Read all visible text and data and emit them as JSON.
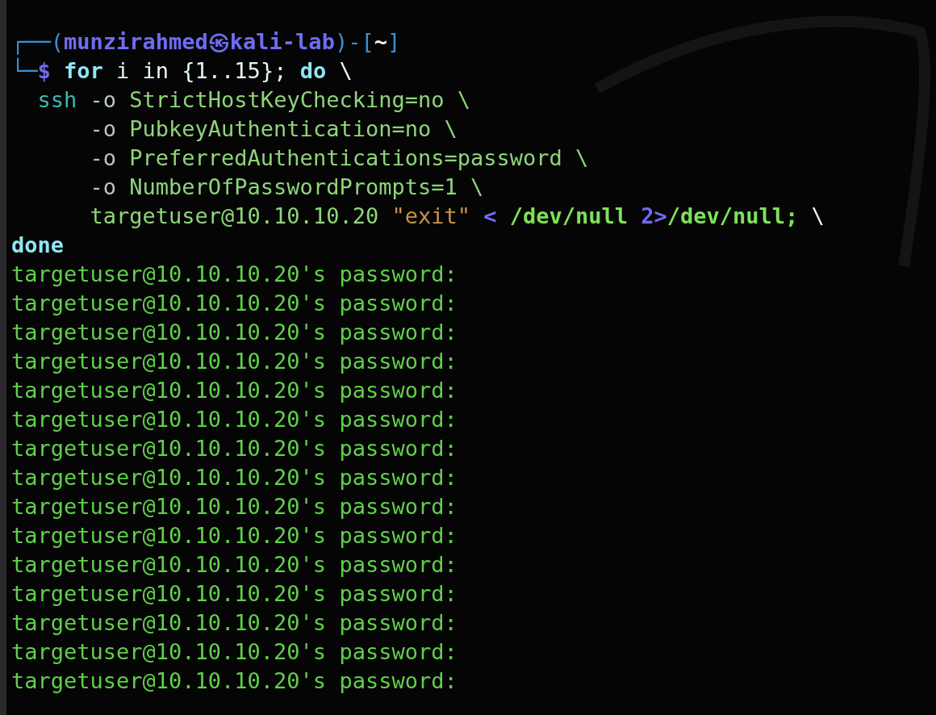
{
  "terminal": {
    "lines": [
      [
        {
          "text": "┌──(",
          "kind": "frame"
        },
        {
          "text": "munzirahmed㉿kali-lab",
          "kind": "userhost"
        },
        {
          "text": ")-[",
          "kind": "frame"
        },
        {
          "text": "~",
          "kind": "cwd"
        },
        {
          "text": "]",
          "kind": "frame"
        }
      ],
      [
        {
          "text": "└─",
          "kind": "frame"
        },
        {
          "text": "$",
          "kind": "dollar"
        },
        {
          "text": " for",
          "kind": "keyword"
        },
        {
          "text": " i in {1..15}; ",
          "kind": "plain"
        },
        {
          "text": "do",
          "kind": "keyword"
        },
        {
          "text": " \\",
          "kind": "plain"
        }
      ],
      [
        {
          "text": "  ssh",
          "kind": "command"
        },
        {
          "text": " -o",
          "kind": "option"
        },
        {
          "text": " StrictHostKeyChecking=no \\",
          "kind": "arg"
        }
      ],
      [
        {
          "text": "      -o",
          "kind": "option"
        },
        {
          "text": " PubkeyAuthentication=no \\",
          "kind": "arg"
        }
      ],
      [
        {
          "text": "      -o",
          "kind": "option"
        },
        {
          "text": " PreferredAuthentications=password \\",
          "kind": "arg"
        }
      ],
      [
        {
          "text": "      -o",
          "kind": "option"
        },
        {
          "text": " NumberOfPasswordPrompts=1 \\",
          "kind": "arg"
        }
      ],
      [
        {
          "text": "      targetuser@10.10.10.20 ",
          "kind": "arg"
        },
        {
          "text": "\"exit\" ",
          "kind": "string"
        },
        {
          "text": "<",
          "kind": "redirect"
        },
        {
          "text": " /dev/null ",
          "kind": "path"
        },
        {
          "text": "2>",
          "kind": "redirect"
        },
        {
          "text": "/dev/null;",
          "kind": "path"
        },
        {
          "text": " \\",
          "kind": "plain"
        }
      ],
      [
        {
          "text": "done",
          "kind": "keyword"
        }
      ]
    ],
    "output": [
      "targetuser@10.10.10.20's password:",
      "targetuser@10.10.10.20's password:",
      "targetuser@10.10.10.20's password:",
      "targetuser@10.10.10.20's password:",
      "targetuser@10.10.10.20's password:",
      "targetuser@10.10.10.20's password:",
      "targetuser@10.10.10.20's password:",
      "targetuser@10.10.10.20's password:",
      "targetuser@10.10.10.20's password:",
      "targetuser@10.10.10.20's password:",
      "targetuser@10.10.10.20's password:",
      "targetuser@10.10.10.20's password:",
      "targetuser@10.10.10.20's password:",
      "targetuser@10.10.10.20's password:",
      "targetuser@10.10.10.20's password:"
    ]
  }
}
